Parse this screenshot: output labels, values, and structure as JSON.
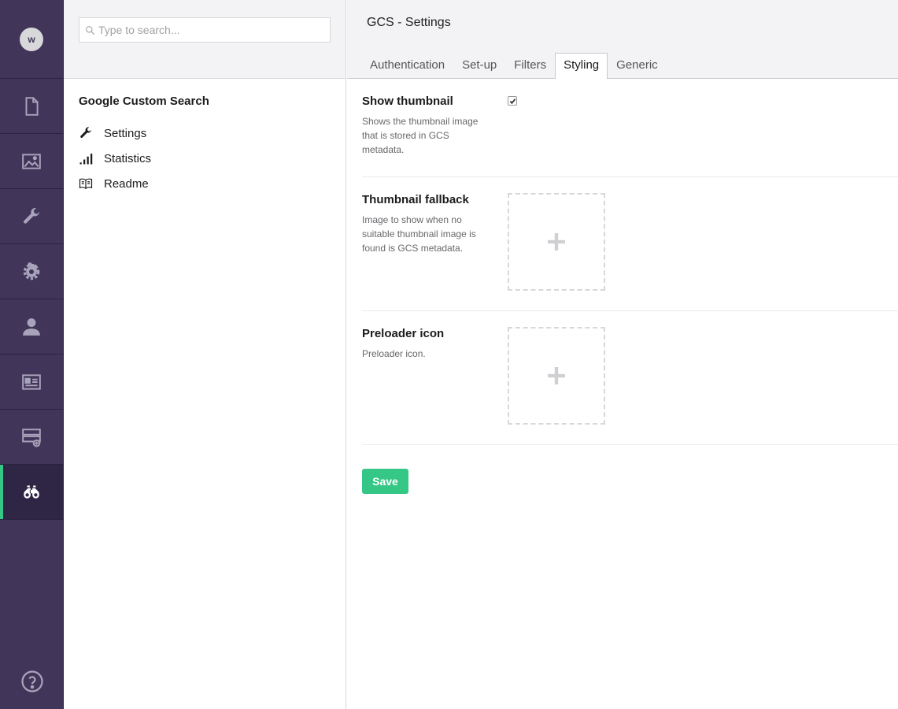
{
  "rail": {
    "avatar_initial": "w",
    "active_color": "#35c786",
    "items": [
      {
        "icon": "document-icon"
      },
      {
        "icon": "image-icon"
      },
      {
        "icon": "wrench-icon"
      },
      {
        "icon": "gear-icon"
      },
      {
        "icon": "user-icon"
      },
      {
        "icon": "id-card-icon"
      },
      {
        "icon": "form-add-icon"
      },
      {
        "icon": "binoculars-icon",
        "active": true
      }
    ],
    "help_icon": "help-icon"
  },
  "tree": {
    "search_placeholder": "Type to search...",
    "section_title": "Google Custom Search",
    "items": [
      {
        "label": "Settings",
        "icon": "wrench-icon"
      },
      {
        "label": "Statistics",
        "icon": "bar-chart-icon"
      },
      {
        "label": "Readme",
        "icon": "book-icon"
      }
    ]
  },
  "main": {
    "title": "GCS - Settings",
    "tabs": [
      {
        "label": "Authentication"
      },
      {
        "label": "Set-up"
      },
      {
        "label": "Filters"
      },
      {
        "label": "Styling",
        "active": true
      },
      {
        "label": "Generic"
      }
    ],
    "properties": [
      {
        "title": "Show thumbnail",
        "description": "Shows the thumbnail image that is stored in GCS metadata.",
        "type": "checkbox",
        "checked": true
      },
      {
        "title": "Thumbnail fallback",
        "description": "Image to show when no suitable thumbnail image is found is GCS metadata.",
        "type": "image-picker"
      },
      {
        "title": "Preloader icon",
        "description": "Preloader icon.",
        "type": "image-picker"
      }
    ],
    "save_label": "Save",
    "save_color": "#35c786"
  }
}
